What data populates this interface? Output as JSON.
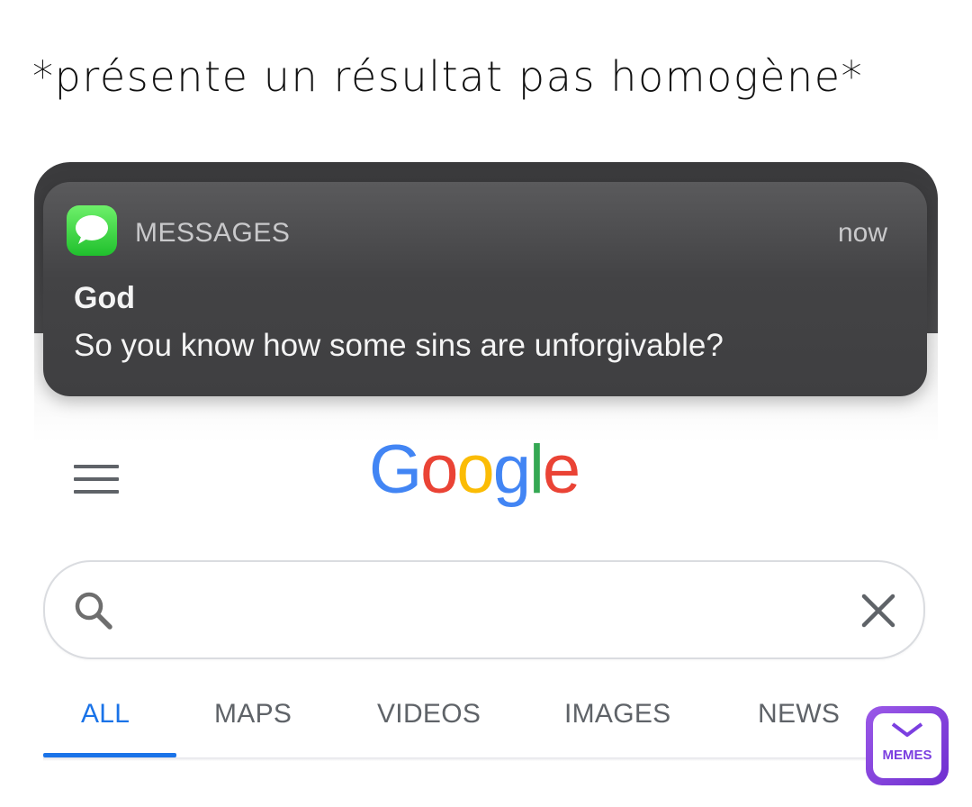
{
  "caption": "*présente un résultat pas homogène*",
  "notification": {
    "app_icon": "messages-bubble-icon",
    "app_name": "MESSAGES",
    "time": "now",
    "sender": "God",
    "message": "So you know how some sins are unforgivable?"
  },
  "google": {
    "menu_icon": "hamburger-menu-icon",
    "logo_letters": [
      "G",
      "o",
      "o",
      "g",
      "l",
      "e"
    ],
    "logo_colors": [
      "#4285f4",
      "#ea4335",
      "#fbbc05",
      "#4285f4",
      "#34a853",
      "#ea4335"
    ],
    "search": {
      "value": "",
      "search_icon": "search-icon",
      "clear_icon": "close-icon"
    },
    "tabs": [
      {
        "label": "ALL",
        "active": true
      },
      {
        "label": "MAPS",
        "active": false
      },
      {
        "label": "VIDEOS",
        "active": false
      },
      {
        "label": "IMAGES",
        "active": false
      },
      {
        "label": "NEWS",
        "active": false
      }
    ],
    "accent_color": "#1a73e8"
  },
  "watermark": {
    "label": "MEMES"
  }
}
